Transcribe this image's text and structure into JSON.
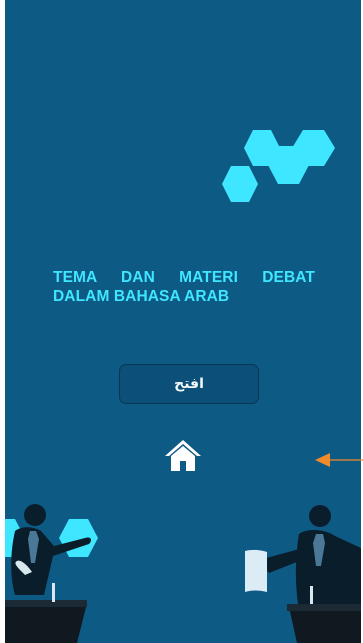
{
  "screen": {
    "title": "TEMA DAN MATERI DEBAT DALAM BAHASA ARAB",
    "open_button_label": "افتح"
  },
  "colors": {
    "background": "#0d5a85",
    "accent_cyan": "#3fe6ff",
    "button_fill": "#0c4f78",
    "button_border": "#083552",
    "home_icon": "#ffffff",
    "pointer_arrow": "#f08a2a",
    "silhouette": "#0a1d2b"
  },
  "icons": {
    "home": "home-icon",
    "pointer": "orange-arrow-icon"
  }
}
